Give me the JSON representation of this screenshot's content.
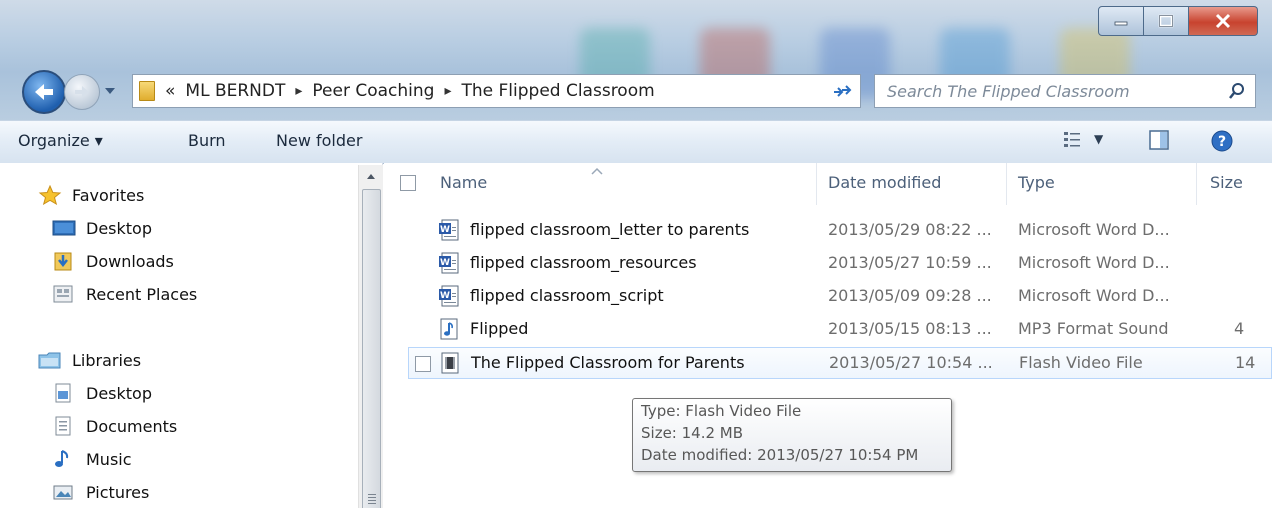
{
  "window": {
    "caption_buttons": [
      "minimize-icon",
      "maximize-icon",
      "close-icon"
    ]
  },
  "address": {
    "overflow": "«",
    "crumbs": [
      "ML BERNDT",
      "Peer Coaching",
      "The Flipped Classroom"
    ],
    "separator": "▸"
  },
  "search": {
    "placeholder": "Search The Flipped Classroom"
  },
  "toolbar": {
    "organize": "Organize ▾",
    "burn": "Burn",
    "new_folder": "New folder"
  },
  "navpane": {
    "favorites_label": "Favorites",
    "favorites": [
      "Desktop",
      "Downloads",
      "Recent Places"
    ],
    "libraries_label": "Libraries",
    "libraries": [
      "Desktop",
      "Documents",
      "Music",
      "Pictures"
    ]
  },
  "columns": {
    "name": "Name",
    "date": "Date modified",
    "type": "Type",
    "size": "Size"
  },
  "files": [
    {
      "name": "flipped classroom_letter to parents",
      "date": "2013/05/29 08:22 ...",
      "type": "Microsoft Word D...",
      "size": "",
      "icon": "word-doc-icon"
    },
    {
      "name": "flipped classroom_resources",
      "date": "2013/05/27 10:59 ...",
      "type": "Microsoft Word D...",
      "size": "",
      "icon": "word-doc-icon"
    },
    {
      "name": "flipped classroom_script",
      "date": "2013/05/09 09:28 ...",
      "type": "Microsoft Word D...",
      "size": "",
      "icon": "word-doc-icon"
    },
    {
      "name": "Flipped",
      "date": "2013/05/15 08:13 ...",
      "type": "MP3 Format Sound",
      "size": "4",
      "icon": "audio-file-icon"
    },
    {
      "name": "The Flipped Classroom for Parents",
      "date": "2013/05/27 10:54 ...",
      "type": "Flash Video File",
      "size": "14",
      "icon": "video-file-icon"
    }
  ],
  "tooltip": {
    "type": "Type: Flash Video File",
    "size": "Size: 14.2 MB",
    "date": "Date modified: 2013/05/27 10:54 PM"
  }
}
